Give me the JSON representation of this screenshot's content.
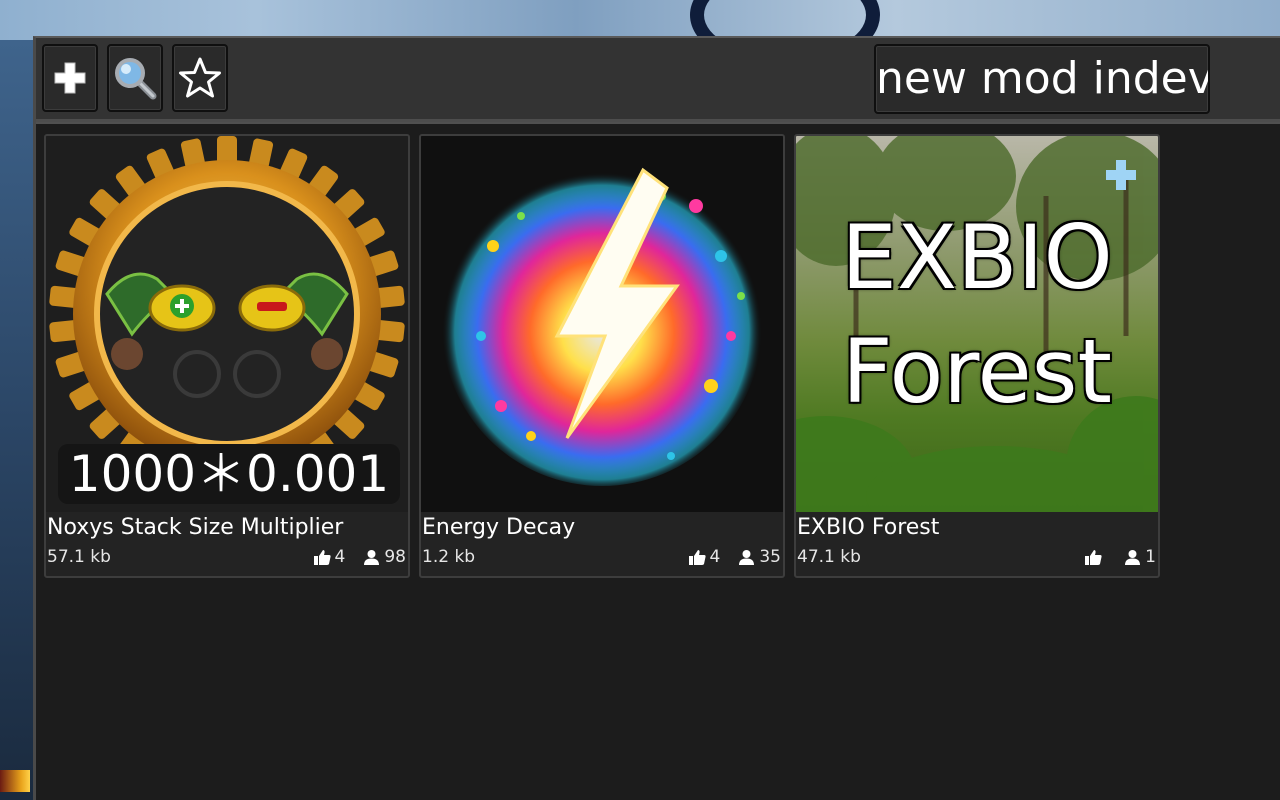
{
  "toolbar": {
    "buttons": [
      {
        "name": "add",
        "icon": "plus-icon"
      },
      {
        "name": "search",
        "icon": "search-icon"
      },
      {
        "name": "favorites",
        "icon": "star-icon"
      }
    ],
    "title": "new mod indev"
  },
  "mods": [
    {
      "title": "Noxys Stack Size Multiplier",
      "size": "57.1 kb",
      "likes": "4",
      "users": "98",
      "thumbnail_text": "1000＊0.001"
    },
    {
      "title": "Energy Decay",
      "size": "1.2 kb",
      "likes": "4",
      "users": "35"
    },
    {
      "title": "EXBIO Forest",
      "size": "47.1 kb",
      "likes": "",
      "users": "1",
      "thumbnail_text_line1": "EXBIO",
      "thumbnail_text_line2": "Forest",
      "badge_icon": "plus-icon",
      "badge_color": "#9fd4f5"
    }
  ],
  "colors": {
    "window_bg": "#1c1c1c",
    "toolbar_bg": "#333333",
    "card_bg": "#232323",
    "text": "#ffffff"
  }
}
